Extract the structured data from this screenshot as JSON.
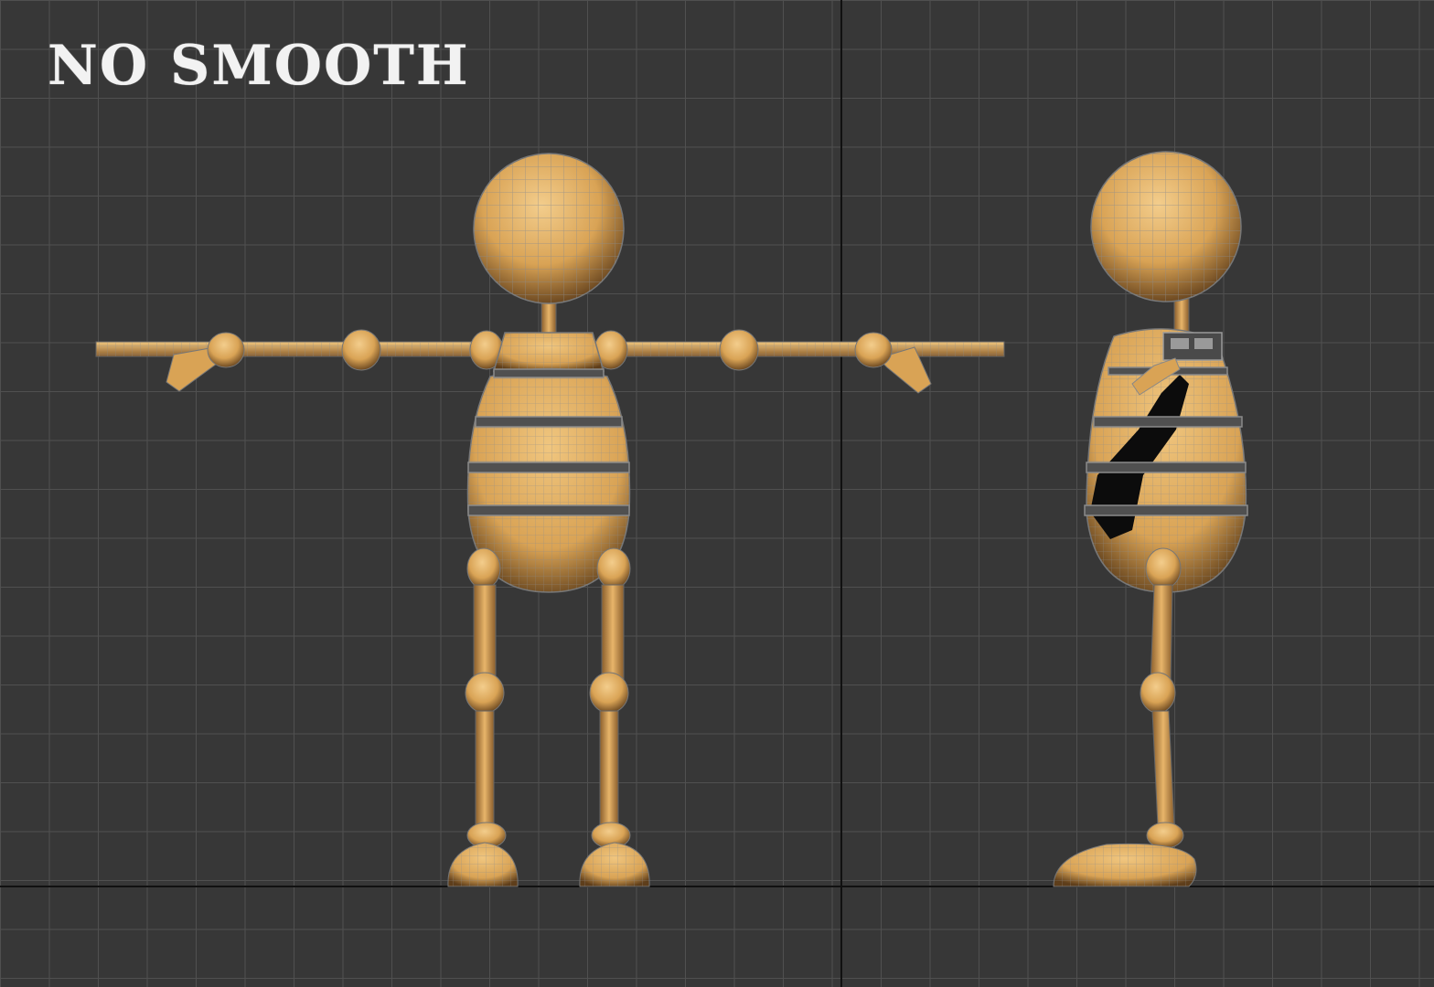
{
  "viewport": {
    "label": "NO SMOOTH",
    "background_color": "#373737",
    "grid_color": "#505050",
    "axis_color": "#111111"
  },
  "model": {
    "material_color": "#d9a355",
    "material_highlight": "#efc47e",
    "material_shadow": "#7a5226",
    "wire_color": "#9a9a9a",
    "views": [
      "front-view",
      "side-view"
    ]
  }
}
